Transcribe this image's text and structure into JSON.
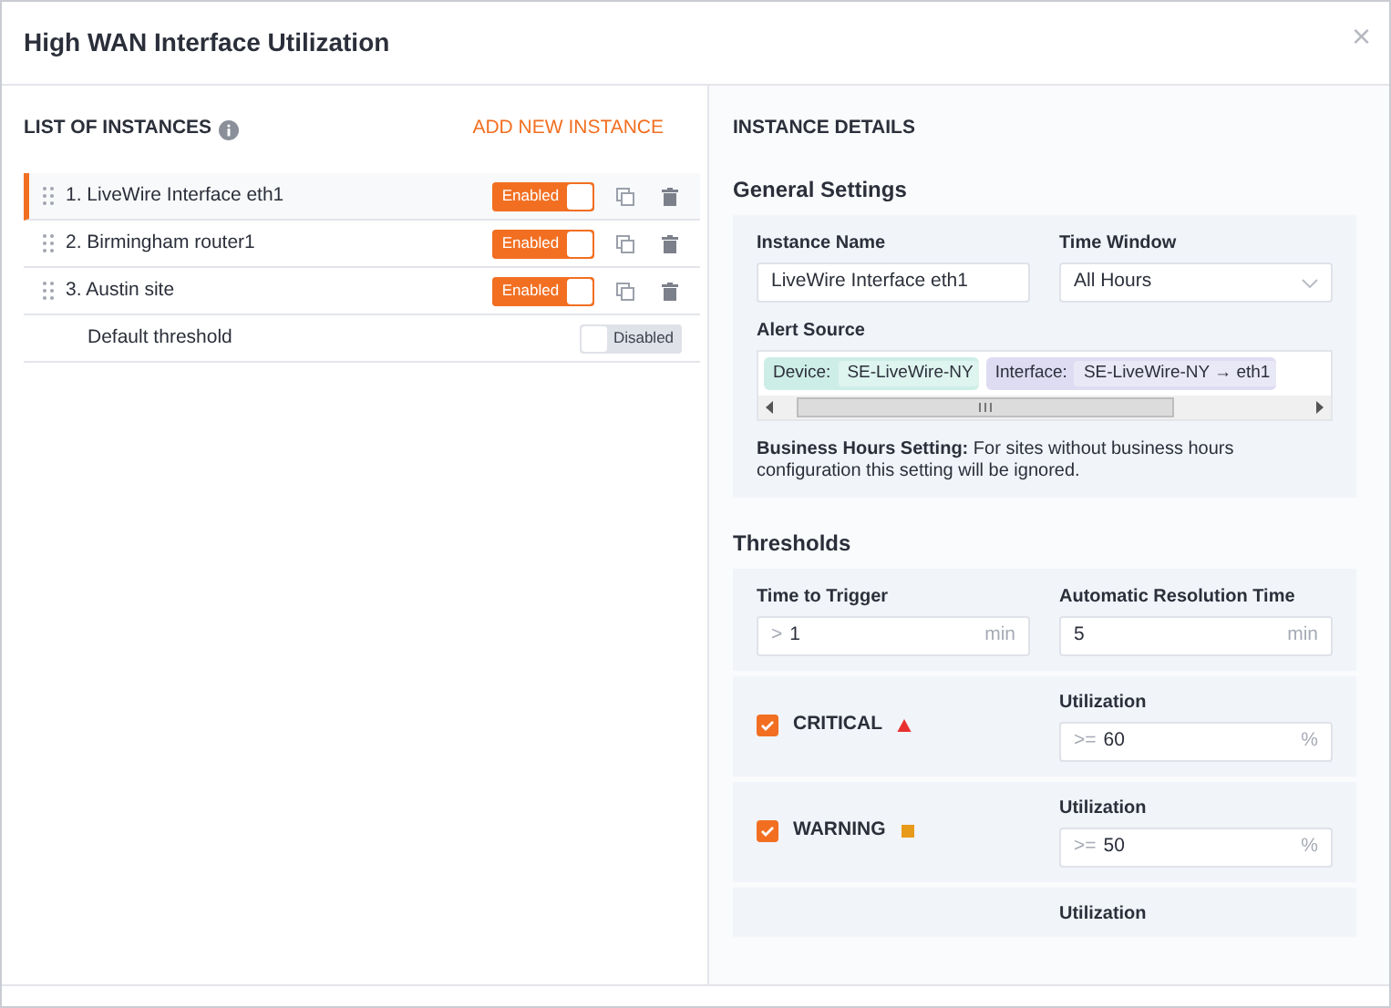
{
  "dialog": {
    "title": "High WAN Interface Utilization",
    "close": "×"
  },
  "instances": {
    "heading": "LIST OF INSTANCES",
    "add_label": "ADD NEW INSTANCE",
    "items": [
      {
        "kind": "instance",
        "label": "1. LiveWire Interface eth1",
        "selected": true,
        "toggle": "Enabled",
        "on": true
      },
      {
        "kind": "instance",
        "label": "2. Birmingham router1",
        "selected": false,
        "toggle": "Enabled",
        "on": true
      },
      {
        "kind": "instance",
        "label": "3. Austin site",
        "selected": false,
        "toggle": "Enabled",
        "on": true
      },
      {
        "kind": "default",
        "label": "Default threshold",
        "selected": false,
        "toggle": "Disabled",
        "on": false
      }
    ]
  },
  "details": {
    "heading": "INSTANCE DETAILS",
    "general": {
      "title": "General Settings",
      "fields": [
        {
          "kind": "text",
          "label": "Instance Name",
          "value": "LiveWire Interface eth1"
        },
        {
          "kind": "select",
          "label": "Time Window",
          "value": "All Hours"
        }
      ],
      "alert_source": {
        "label": "Alert Source",
        "tags": [
          {
            "key": "Device:",
            "value": "SE-LiveWire-NY",
            "color": "#cdeee6"
          },
          {
            "key": "Interface:",
            "value": "SE-LiveWire-NY → eth1",
            "color": "#dedcf2"
          }
        ]
      },
      "note": "**Business Hours Setting:** For sites without business hours configuration this setting will be ignored."
    },
    "thresholds": {
      "title": "Thresholds",
      "timing": [
        {
          "label": "Time to Trigger",
          "prefix": ">",
          "value": "1",
          "unit": "min"
        },
        {
          "label": "Automatic Resolution Time",
          "value": "5",
          "unit": "min"
        }
      ],
      "levels": [
        {
          "name": "CRITICAL",
          "checked": true,
          "kind": "triangle",
          "color": "#e8312f",
          "field_label": "Utilization",
          "prefix": ">=",
          "value": "60",
          "unit": "%"
        },
        {
          "name": "WARNING",
          "checked": true,
          "kind": "square",
          "color": "#e89a1a",
          "field_label": "Utilization",
          "prefix": ">=",
          "value": "50",
          "unit": "%"
        }
      ],
      "cut_label": "Utilization"
    }
  }
}
